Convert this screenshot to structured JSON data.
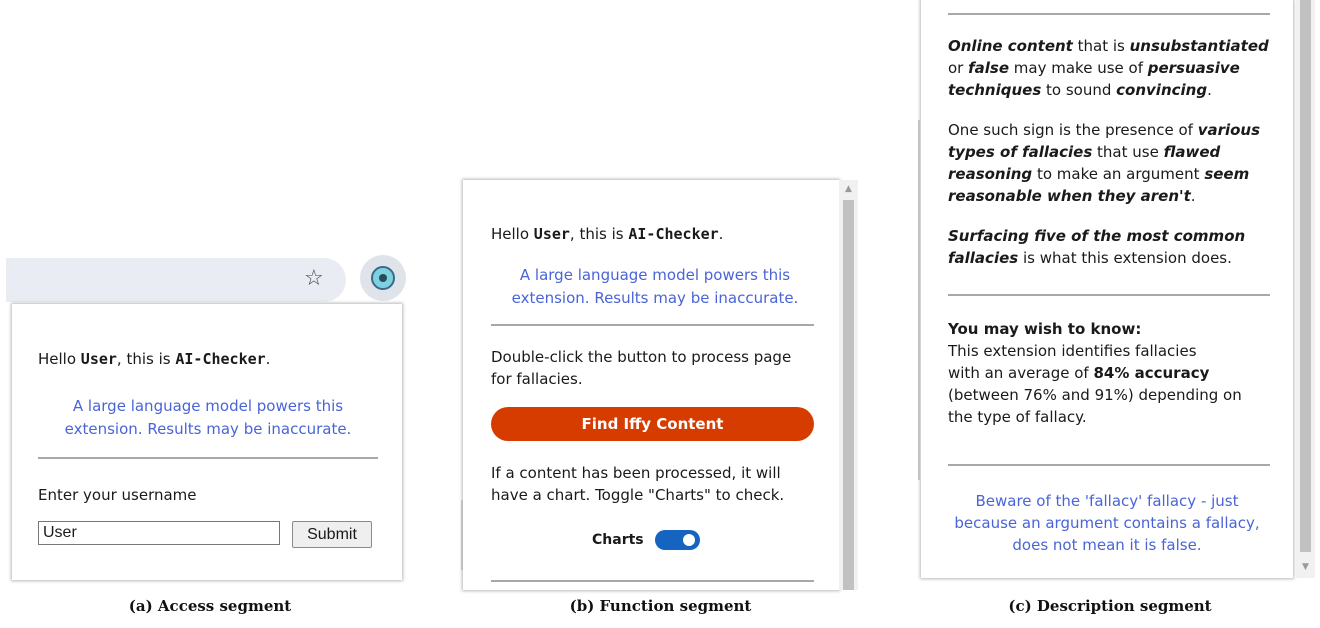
{
  "panel_a": {
    "greeting_prefix": "Hello ",
    "user": "User",
    "greeting_mid": ", this is ",
    "app_name": "AI-Checker",
    "greeting_end": ".",
    "notice_line1": "A large language model powers this",
    "notice_line2": "extension. Results may be inaccurate.",
    "username_label": "Enter your username",
    "username_value": "User",
    "submit_label": "Submit",
    "star_icon": "☆",
    "caption": "(a) Access segment"
  },
  "panel_b": {
    "greeting_prefix": "Hello ",
    "user": "User",
    "greeting_mid": ", this is ",
    "app_name": "AI-Checker",
    "greeting_end": ".",
    "notice_line1": "A large language model powers this",
    "notice_line2": "extension. Results may be inaccurate.",
    "instruction_line1": "Double-click the button to process page",
    "instruction_line2": "for fallacies.",
    "find_button": "Find Iffy Content",
    "chart_hint_line1": "If a content has been processed, it will",
    "chart_hint_line2": "have a chart. Toggle \"Charts\" to check.",
    "charts_label": "Charts",
    "charts_on": true,
    "scroll_up_icon": "▲",
    "caption": "(b) Function segment"
  },
  "panel_c": {
    "p1": {
      "s1": "Online content",
      "s2": " that is ",
      "s3": "unsubstantiated",
      "s4": "or ",
      "s5": "false",
      "s6": " may make use of ",
      "s7": "persuasive",
      "s8": "techniques",
      "s9": " to sound ",
      "s10": "convincing",
      "s11": "."
    },
    "p2": {
      "s1": "One such sign is the presence of ",
      "s2": "various",
      "s3": "types of fallacies",
      "s4": " that use ",
      "s5": "flawed",
      "s6": "reasoning",
      "s7": " to make an argument ",
      "s8": "seem",
      "s9": "reasonable when they aren't",
      "s10": "."
    },
    "p3": {
      "s1": "Surfacing five of the most common",
      "s2": "fallacies",
      "s3": " is what this extension does."
    },
    "know_heading": "You may wish to know:",
    "know_line1": "This extension identifies fallacies",
    "know_line2_prefix": "with an average of ",
    "know_accuracy": "84% accuracy",
    "know_line3": "(between 76% and 91%) depending on",
    "know_line4": "the type of fallacy.",
    "beware_line1": "Beware of the 'fallacy' fallacy - just",
    "beware_line2": "because an argument contains a fallacy,",
    "beware_line3": "does not mean it is false.",
    "scroll_down_icon": "▼",
    "caption": "(c) Description segment"
  }
}
